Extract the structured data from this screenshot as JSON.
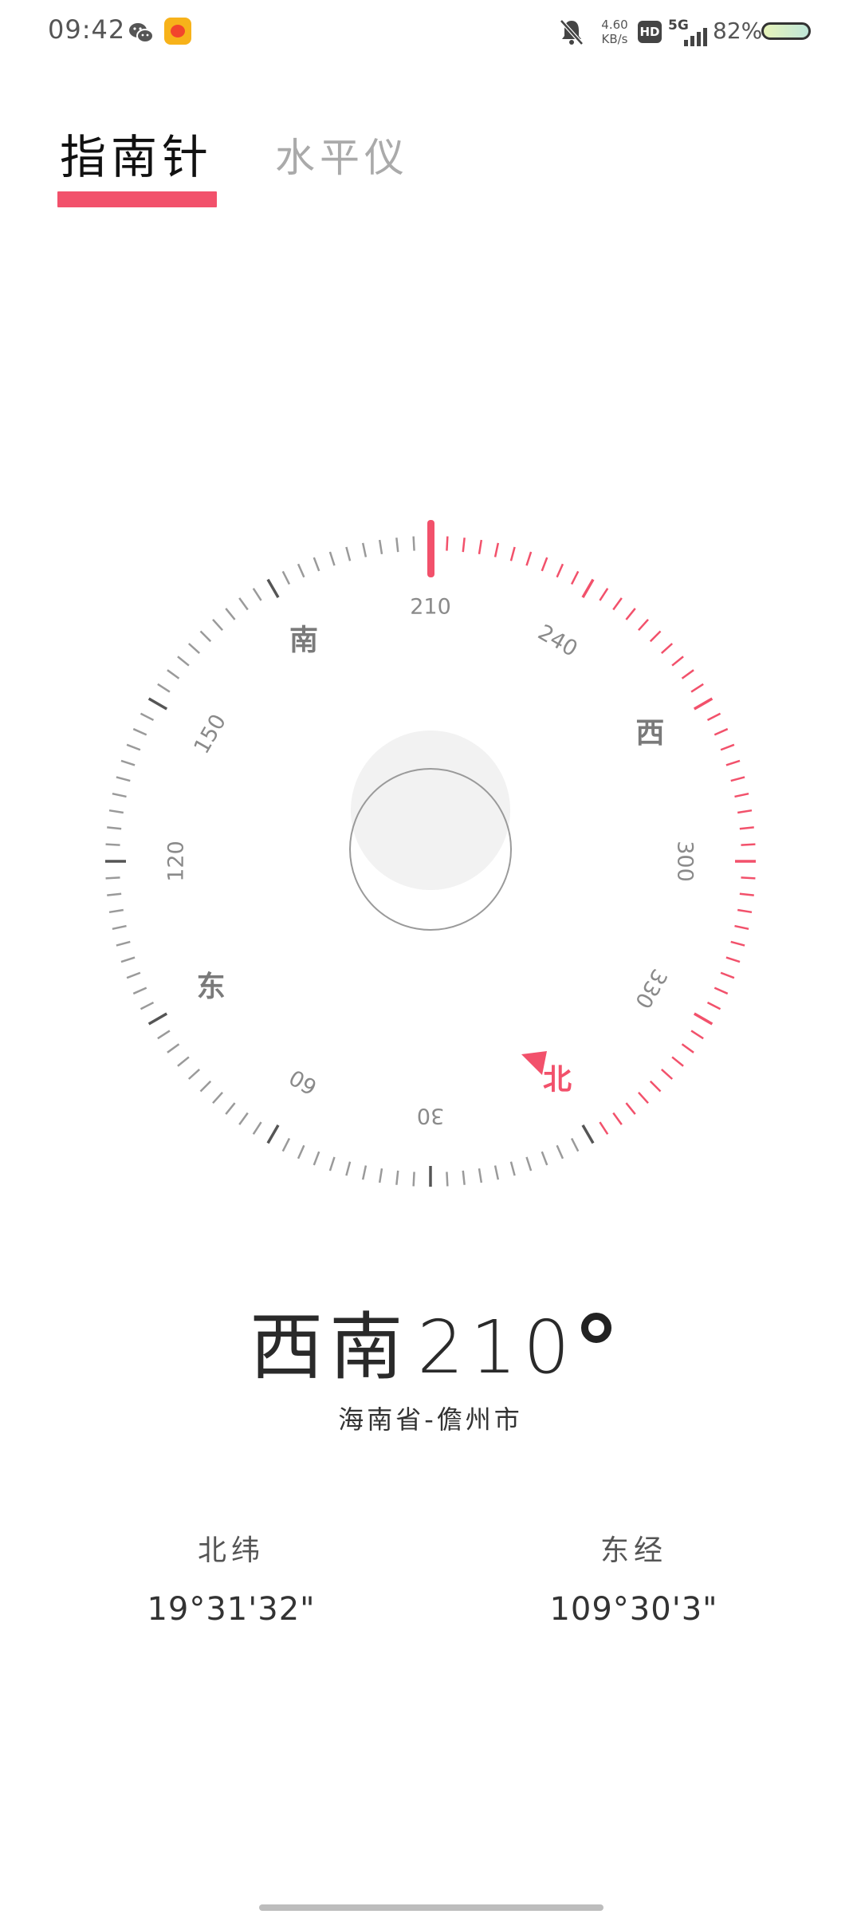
{
  "status_bar": {
    "time": "09:42",
    "net_speed_value": "4.60",
    "net_speed_unit": "KB/s",
    "hd_label": "HD",
    "network_label": "5G",
    "battery_percent": "82%",
    "battery_level": 0.82,
    "icons": [
      "wechat-icon",
      "app-notification-icon",
      "mute-bell-icon",
      "hd-icon",
      "signal-5g-icon",
      "battery-icon"
    ]
  },
  "tabs": [
    {
      "label": "指南针",
      "active": true
    },
    {
      "label": "水平仪",
      "active": false
    }
  ],
  "compass": {
    "heading_deg": 210,
    "dial_numbers": [
      "210",
      "240",
      "300",
      "330",
      "30",
      "60",
      "120",
      "150"
    ],
    "cardinals": {
      "north": "北",
      "south": "南",
      "east": "东",
      "west": "西"
    },
    "colors": {
      "accent": "#f2516b",
      "tick": "#9a9a9a",
      "major_tick": "#555555"
    }
  },
  "heading": {
    "direction": "西南",
    "degrees": "210"
  },
  "location": "海南省-儋州市",
  "coordinates": {
    "latitude_label": "北纬",
    "latitude_value": "19°31'32\"",
    "longitude_label": "东经",
    "longitude_value": "109°30'3\""
  }
}
